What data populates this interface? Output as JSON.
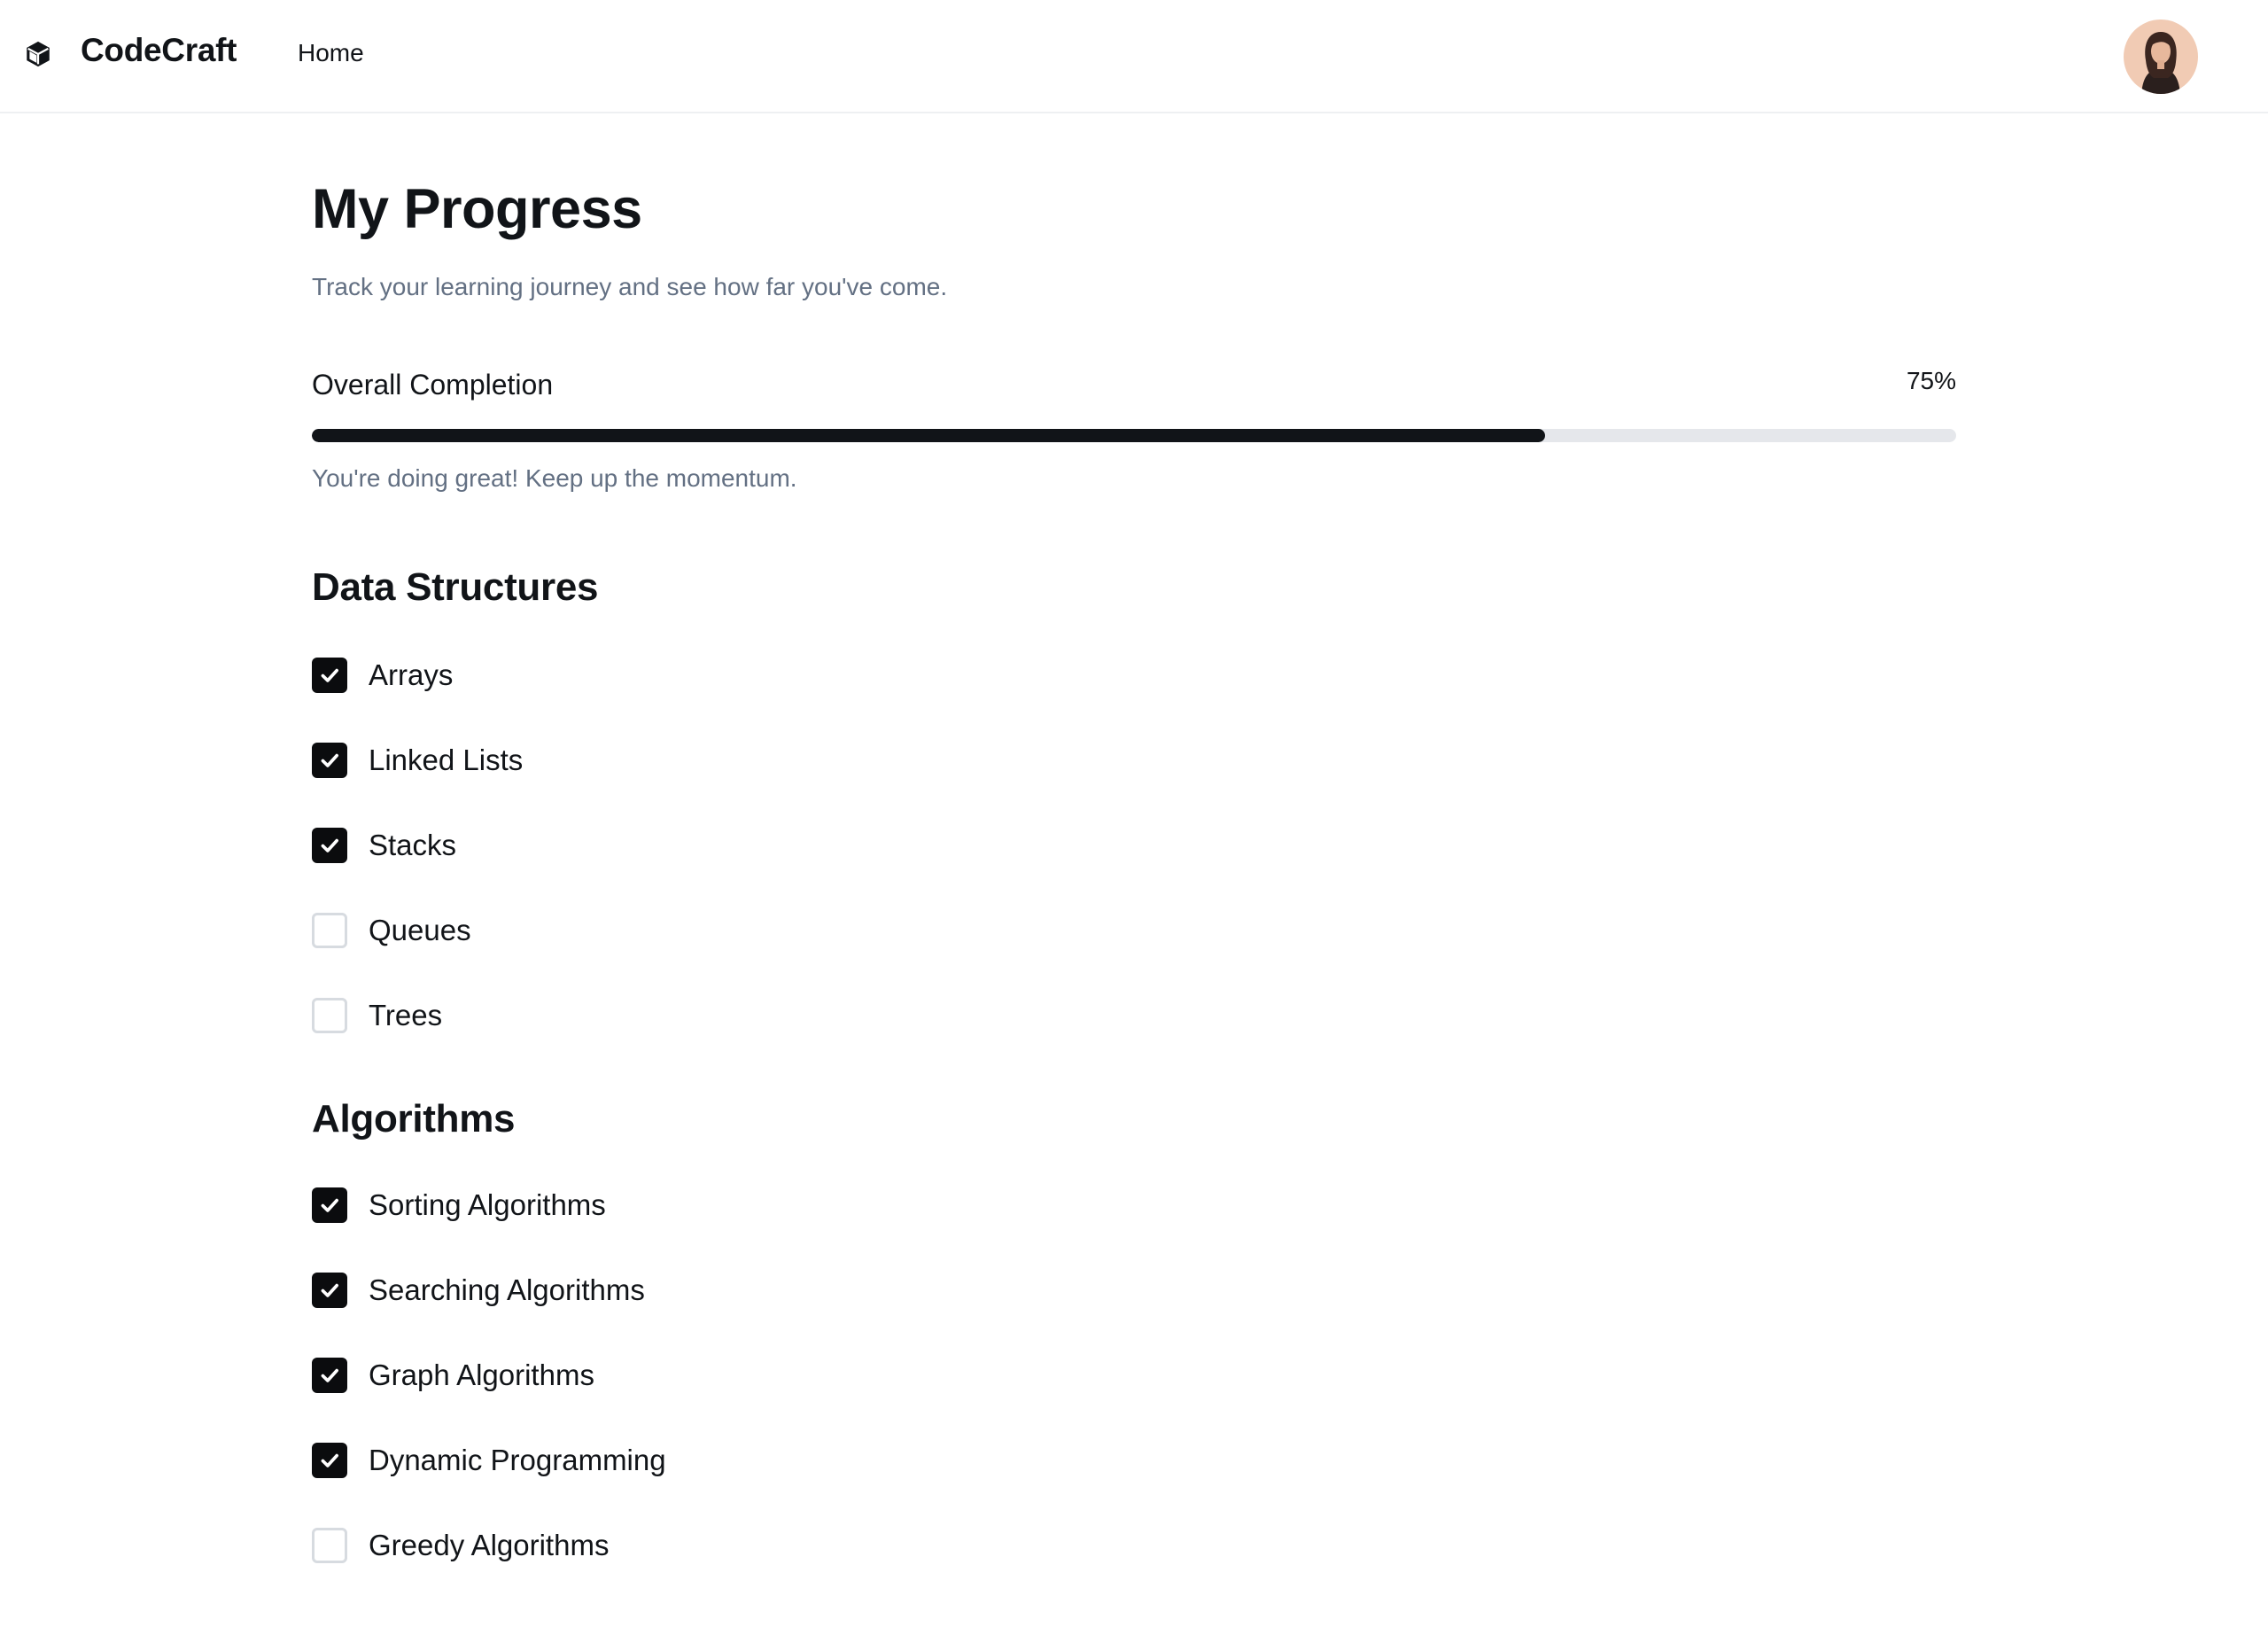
{
  "header": {
    "brand": "CodeCraft",
    "logo_icon": "cube-icon",
    "nav": [
      {
        "label": "Home"
      }
    ],
    "avatar_icon": "user-avatar"
  },
  "page": {
    "title": "My Progress",
    "subtitle": "Track your learning journey and see how far you've come."
  },
  "progress": {
    "label": "Overall Completion",
    "value_text": "75%",
    "fraction": 0.75,
    "note": "You're doing great! Keep up the momentum.",
    "fill_color": "#111418",
    "track_color": "#e5e7eb"
  },
  "sections": [
    {
      "title": "Data Structures",
      "items": [
        {
          "label": "Arrays",
          "checked": true
        },
        {
          "label": "Linked Lists",
          "checked": true
        },
        {
          "label": "Stacks",
          "checked": true
        },
        {
          "label": "Queues",
          "checked": false
        },
        {
          "label": "Trees",
          "checked": false
        }
      ]
    },
    {
      "title": "Algorithms",
      "items": [
        {
          "label": "Sorting Algorithms",
          "checked": true
        },
        {
          "label": "Searching Algorithms",
          "checked": true
        },
        {
          "label": "Graph Algorithms",
          "checked": true
        },
        {
          "label": "Dynamic Programming",
          "checked": true
        },
        {
          "label": "Greedy Algorithms",
          "checked": false
        }
      ]
    }
  ]
}
